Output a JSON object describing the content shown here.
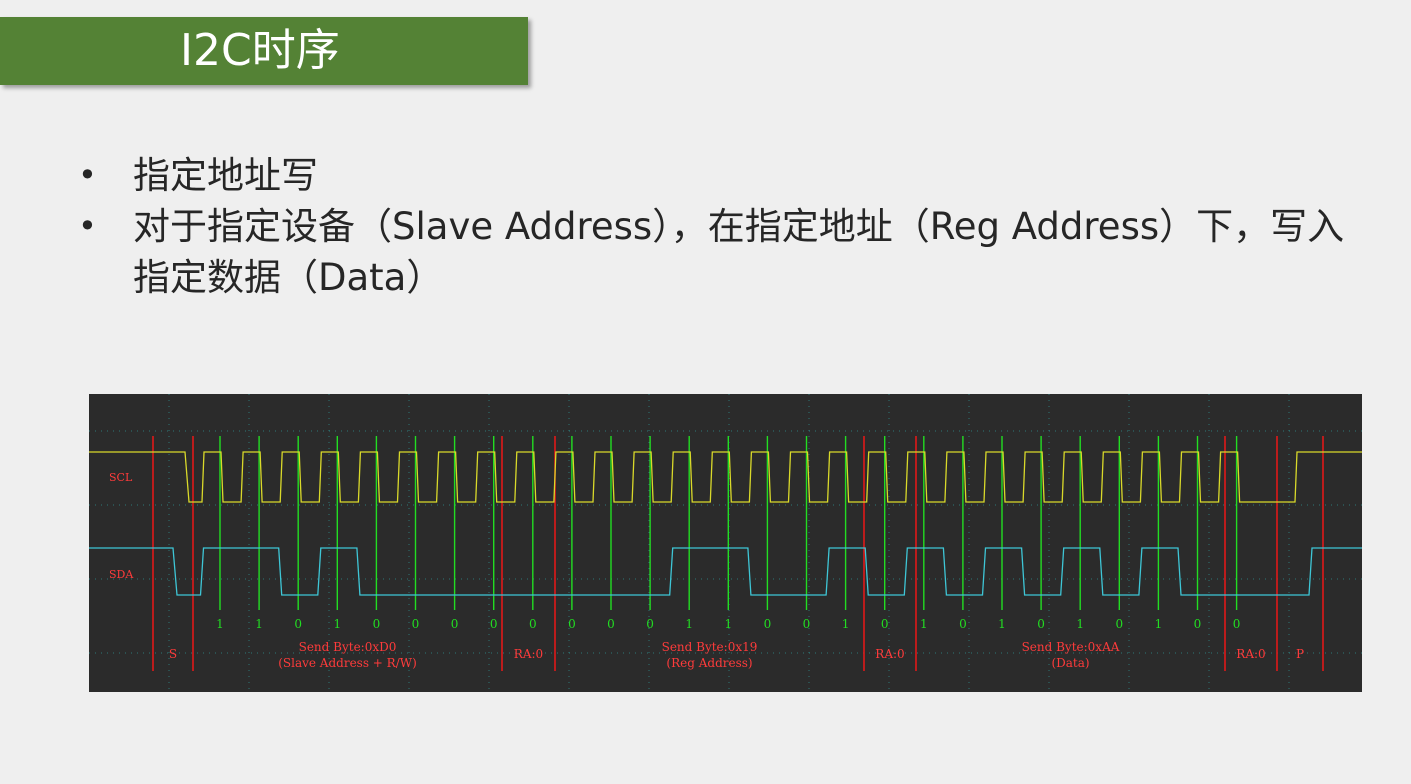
{
  "title": "I2C时序",
  "bullets": [
    {
      "text": "指定地址写"
    },
    {
      "text": "对于指定设备（Slave Address），在指定地址（Reg Address）下，写入指定数据（Data）"
    }
  ],
  "diagram": {
    "channels": {
      "scl": "SCL",
      "sda": "SDA"
    },
    "bits": [
      "1",
      "1",
      "0",
      "1",
      "0",
      "0",
      "0",
      "0",
      "0",
      "0",
      "0",
      "0",
      "1",
      "1",
      "0",
      "0",
      "1",
      "0",
      "1",
      "0",
      "1",
      "0",
      "1",
      "0",
      "1",
      "0",
      "0"
    ],
    "segments": [
      {
        "label": "S"
      },
      {
        "line1": "Send Byte:0xD0",
        "line2": "(Slave Address + R/W)"
      },
      {
        "label": "RA:0"
      },
      {
        "line1": "Send Byte:0x19",
        "line2": "(Reg Address)"
      },
      {
        "label": "RA:0"
      },
      {
        "line1": "Send Byte:0xAA",
        "line2": "(Data)"
      },
      {
        "label": "RA:0"
      },
      {
        "label": "P"
      }
    ],
    "colors": {
      "scl": "#d9d92a",
      "sda": "#3ec6d6",
      "clock_marker": "#22dd22",
      "frame_marker": "#e01818",
      "label": "#ff3b3b",
      "bit": "#22dd22",
      "background": "#2b2b2b"
    }
  }
}
